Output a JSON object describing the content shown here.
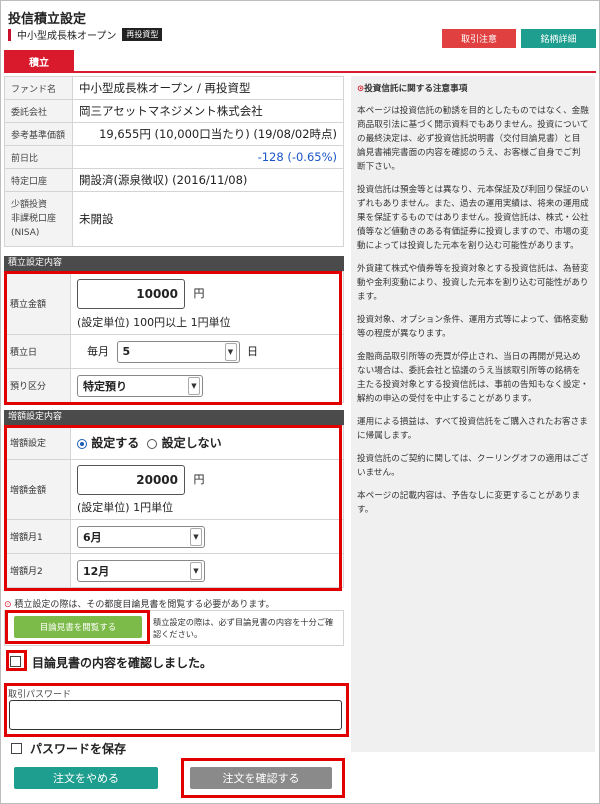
{
  "header": {
    "title": "投信積立設定",
    "fund_short": "中小型成長株オープン",
    "fund_badge": "再投資型",
    "btn_order_cancel": "取引注意",
    "btn_detail": "銘柄詳細"
  },
  "tab": {
    "label": "積立"
  },
  "info_rows": [
    {
      "key": "ファンド名",
      "value": "中小型成長株オープン / 再投資型"
    },
    {
      "key": "委託会社",
      "value": "岡三アセットマネジメント株式会社"
    },
    {
      "key": "参考基準価額",
      "value": "19,655円 (10,000口当たり) (19/08/02時点)"
    },
    {
      "key": "前日比",
      "value": "-128 (-0.65%)"
    },
    {
      "key": "特定口座",
      "value": "開設済(源泉徴収) (2016/11/08)"
    },
    {
      "key": "少額投資非課税口座(NISA)",
      "key_l1": "少額投資",
      "key_l2": "非課税口座",
      "key_l3": "(NISA)",
      "value": "未開設"
    }
  ],
  "sections": {
    "tsumitate": "積立設定内容",
    "zougaku": "増額設定内容"
  },
  "tsumitate": {
    "amount_label": "積立金額",
    "amount_value": "10000",
    "amount_unit": "円",
    "amount_note": "(設定単位) 100円以上 1円単位",
    "day_label": "積立日",
    "day_prefix": "毎月",
    "day_value": "5",
    "day_suffix": "日",
    "deposit_label": "預り区分",
    "deposit_value": "特定預り"
  },
  "zougaku": {
    "setting_label": "増額設定",
    "option_on": "設定する",
    "option_off": "設定しない",
    "amount_label": "増額金額",
    "amount_value": "20000",
    "amount_unit": "円",
    "amount_note": "(設定単位) 1円単位",
    "month1_label": "増額月1",
    "month1_value": "6月",
    "month2_label": "増額月2",
    "month2_value": "12月"
  },
  "prospectus": {
    "warning": "積立設定の際は、その都度目論見書を閲覧する必要があります。",
    "warning_icon": "⊙",
    "button": "目論見書を閲覧する",
    "note": "積立設定の際は、必ず目論見書の内容を十分ご確認ください。",
    "confirm_label": "目論見書の内容を確認しました。"
  },
  "password": {
    "label": "取引パスワード",
    "placeholder": "",
    "save_label": "パスワードを保存"
  },
  "buttons": {
    "cancel": "注文をやめる",
    "confirm": "注文を確認する"
  },
  "notice": {
    "title": "投資信託に関する注意事項",
    "paragraphs": [
      "本ページは投資信託の勧誘を目的としたものではなく、金融商品取引法に基づく開示資料でもありません。投資についての最終決定は、必ず投資信託説明書（交付目論見書）と目論見書補完書面の内容を確認のうえ、お客様ご自身でご判断下さい。",
      "投資信託は預金等とは異なり、元本保証及び利回り保証のいずれもありません。また、過去の運用実績は、将来の運用成果を保証するものではありません。投資信託は、株式・公社債等など値動きのある有価証券に投資しますので、市場の変動によっては投資した元本を割り込む可能性があります。",
      "外貨建て株式や債券等を投資対象とする投資信託は、為替変動や金利変動により、投資した元本を割り込む可能性があります。",
      "投資対象、オプション条件、運用方式等によって、価格変動等の程度が異なります。",
      "金融商品取引所等の売買が停止され、当日の再開が見込めない場合は、委託会社と協議のうえ当該取引所等の銘柄を主たる投資対象とする投資信託は、事前の告知もなく設定・解約の申込の受付を中止することがあります。",
      "運用による損益は、すべて投資信託をご購入されたお客さまに帰属します。",
      "投資信託のご契約に関しては、クーリングオフの適用はございません。",
      "本ページの記載内容は、予告なしに変更することがあります。"
    ]
  },
  "colors": {
    "accent": "#d9192c",
    "teal": "#1e9e8e",
    "highlight": "#e00000",
    "negative": "#1a56c8",
    "green": "#7cbb4a"
  }
}
